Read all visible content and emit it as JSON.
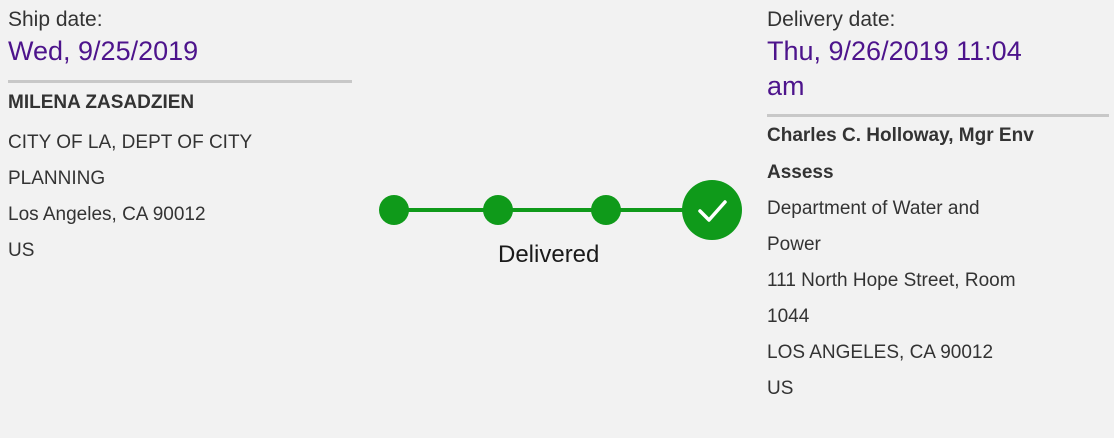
{
  "ship": {
    "label": "Ship date:",
    "date": "Wed, 9/25/2019",
    "name": "MILENA ZASADZIEN",
    "lines": [
      "CITY OF LA, DEPT OF CITY",
      "PLANNING",
      "Los Angeles, CA 90012",
      "US"
    ]
  },
  "delivery": {
    "label": "Delivery date:",
    "date_line1": "Thu, 9/26/2019 11:04",
    "date_line2": "am",
    "name_line1": "Charles C. Holloway, Mgr Env",
    "name_line2": "Assess",
    "lines": [
      "Department of Water and",
      "Power",
      "111 North Hope Street, Room",
      "1044",
      "LOS ANGELES, CA 90012",
      "US"
    ]
  },
  "progress": {
    "status": "Delivered",
    "steps_total": 4,
    "steps_completed": 4,
    "color": "#0f9a1a",
    "check_icon": "check-icon"
  },
  "colors": {
    "date_value": "#4d148c",
    "background": "#f2f2f2",
    "divider": "#c8c8c8"
  }
}
